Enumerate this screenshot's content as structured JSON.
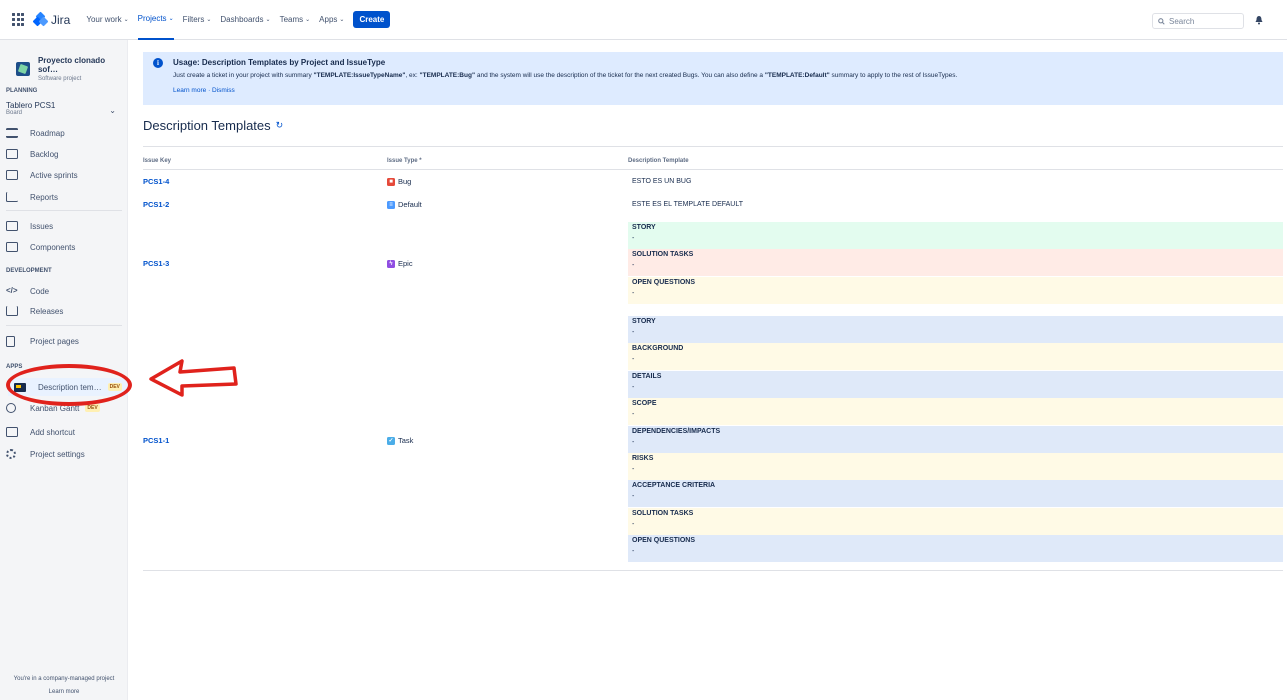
{
  "topnav": {
    "app_name": "Jira",
    "items": [
      {
        "label": "Your work",
        "active": false
      },
      {
        "label": "Projects",
        "active": true
      },
      {
        "label": "Filters",
        "active": false
      },
      {
        "label": "Dashboards",
        "active": false
      },
      {
        "label": "Teams",
        "active": false
      },
      {
        "label": "Apps",
        "active": false
      }
    ],
    "chevron": "⌄",
    "create_label": "Create",
    "search_placeholder": "Search"
  },
  "sidebar": {
    "project_name": "Proyecto clonado sof…",
    "project_type": "Software project",
    "planning_label": "PLANNING",
    "board_name": "Tablero PCS1",
    "board_sub": "Board",
    "items": {
      "roadmap": "Roadmap",
      "backlog": "Backlog",
      "active_sprints": "Active sprints",
      "reports": "Reports",
      "issues": "Issues",
      "components": "Components",
      "code": "Code",
      "releases": "Releases",
      "project_pages": "Project pages",
      "description_templates": "Description tem…",
      "kanban_gantt": "Kanban Gantt",
      "add_shortcut": "Add shortcut",
      "project_settings": "Project settings"
    },
    "development_label": "DEVELOPMENT",
    "apps_label": "APPS",
    "dev_badge": "DEV",
    "footer_text": "You're in a company-managed project",
    "footer_link": "Learn more"
  },
  "banner": {
    "title": "Usage: Description Templates by Project and IssueType",
    "text_1": "Just create a ticket in your project with summary ",
    "text_b1": "\"TEMPLATE:IssueTypeName\"",
    "text_2": ", ex: ",
    "text_b2": "\"TEMPLATE:Bug\"",
    "text_3": " and the system will use the description of the ticket for the next created Bugs. You can also define a ",
    "text_b3": "\"TEMPLATE:Default\"",
    "text_4": " summary to apply to the rest of IssueTypes.",
    "learn_more": "Learn more",
    "separator": "·",
    "dismiss": "Dismiss"
  },
  "page": {
    "title": "Description Templates",
    "refresh_icon": "↻"
  },
  "table": {
    "headers": {
      "issue_key": "Issue Key",
      "issue_type": "Issue Type *",
      "description_template": "Description Template"
    },
    "rows": [
      {
        "key": "PCS1-4",
        "type": "Bug",
        "description": "ESTO ES UN BUG"
      },
      {
        "key": "PCS1-2",
        "type": "Default",
        "description": "ESTE ES EL TEMPLATE DEFAULT"
      },
      {
        "key": "PCS1-3",
        "type": "Epic",
        "sections": [
          {
            "heading": "STORY",
            "value": "-",
            "color": "#e3fcef"
          },
          {
            "heading": "SOLUTION TASKS",
            "value": "-",
            "color": "#ffebe6"
          },
          {
            "heading": "OPEN QUESTIONS",
            "value": "-",
            "color": "#fffae6"
          }
        ]
      },
      {
        "key": "PCS1-1",
        "type": "Task",
        "sections": [
          {
            "heading": "STORY",
            "value": "-",
            "color": "#dfe9f9"
          },
          {
            "heading": "BACKGROUND",
            "value": "-",
            "color": "#fffae6"
          },
          {
            "heading": "DETAILS",
            "value": "-",
            "color": "#dfe9f9"
          },
          {
            "heading": "SCOPE",
            "value": "-",
            "color": "#fffae6"
          },
          {
            "heading": "DEPENDENCIES/IMPACTS",
            "value": "-",
            "color": "#dfe9f9"
          },
          {
            "heading": "RISKS",
            "value": "-",
            "color": "#fffae6"
          },
          {
            "heading": "ACCEPTANCE CRITERIA",
            "value": "-",
            "color": "#dfe9f9"
          },
          {
            "heading": "SOLUTION TASKS",
            "value": "-",
            "color": "#fffae6"
          },
          {
            "heading": "OPEN QUESTIONS",
            "value": "-",
            "color": "#dfe9f9"
          }
        ]
      }
    ]
  },
  "colors": {
    "brand": "#0052cc",
    "annotation": "#e0221c"
  }
}
